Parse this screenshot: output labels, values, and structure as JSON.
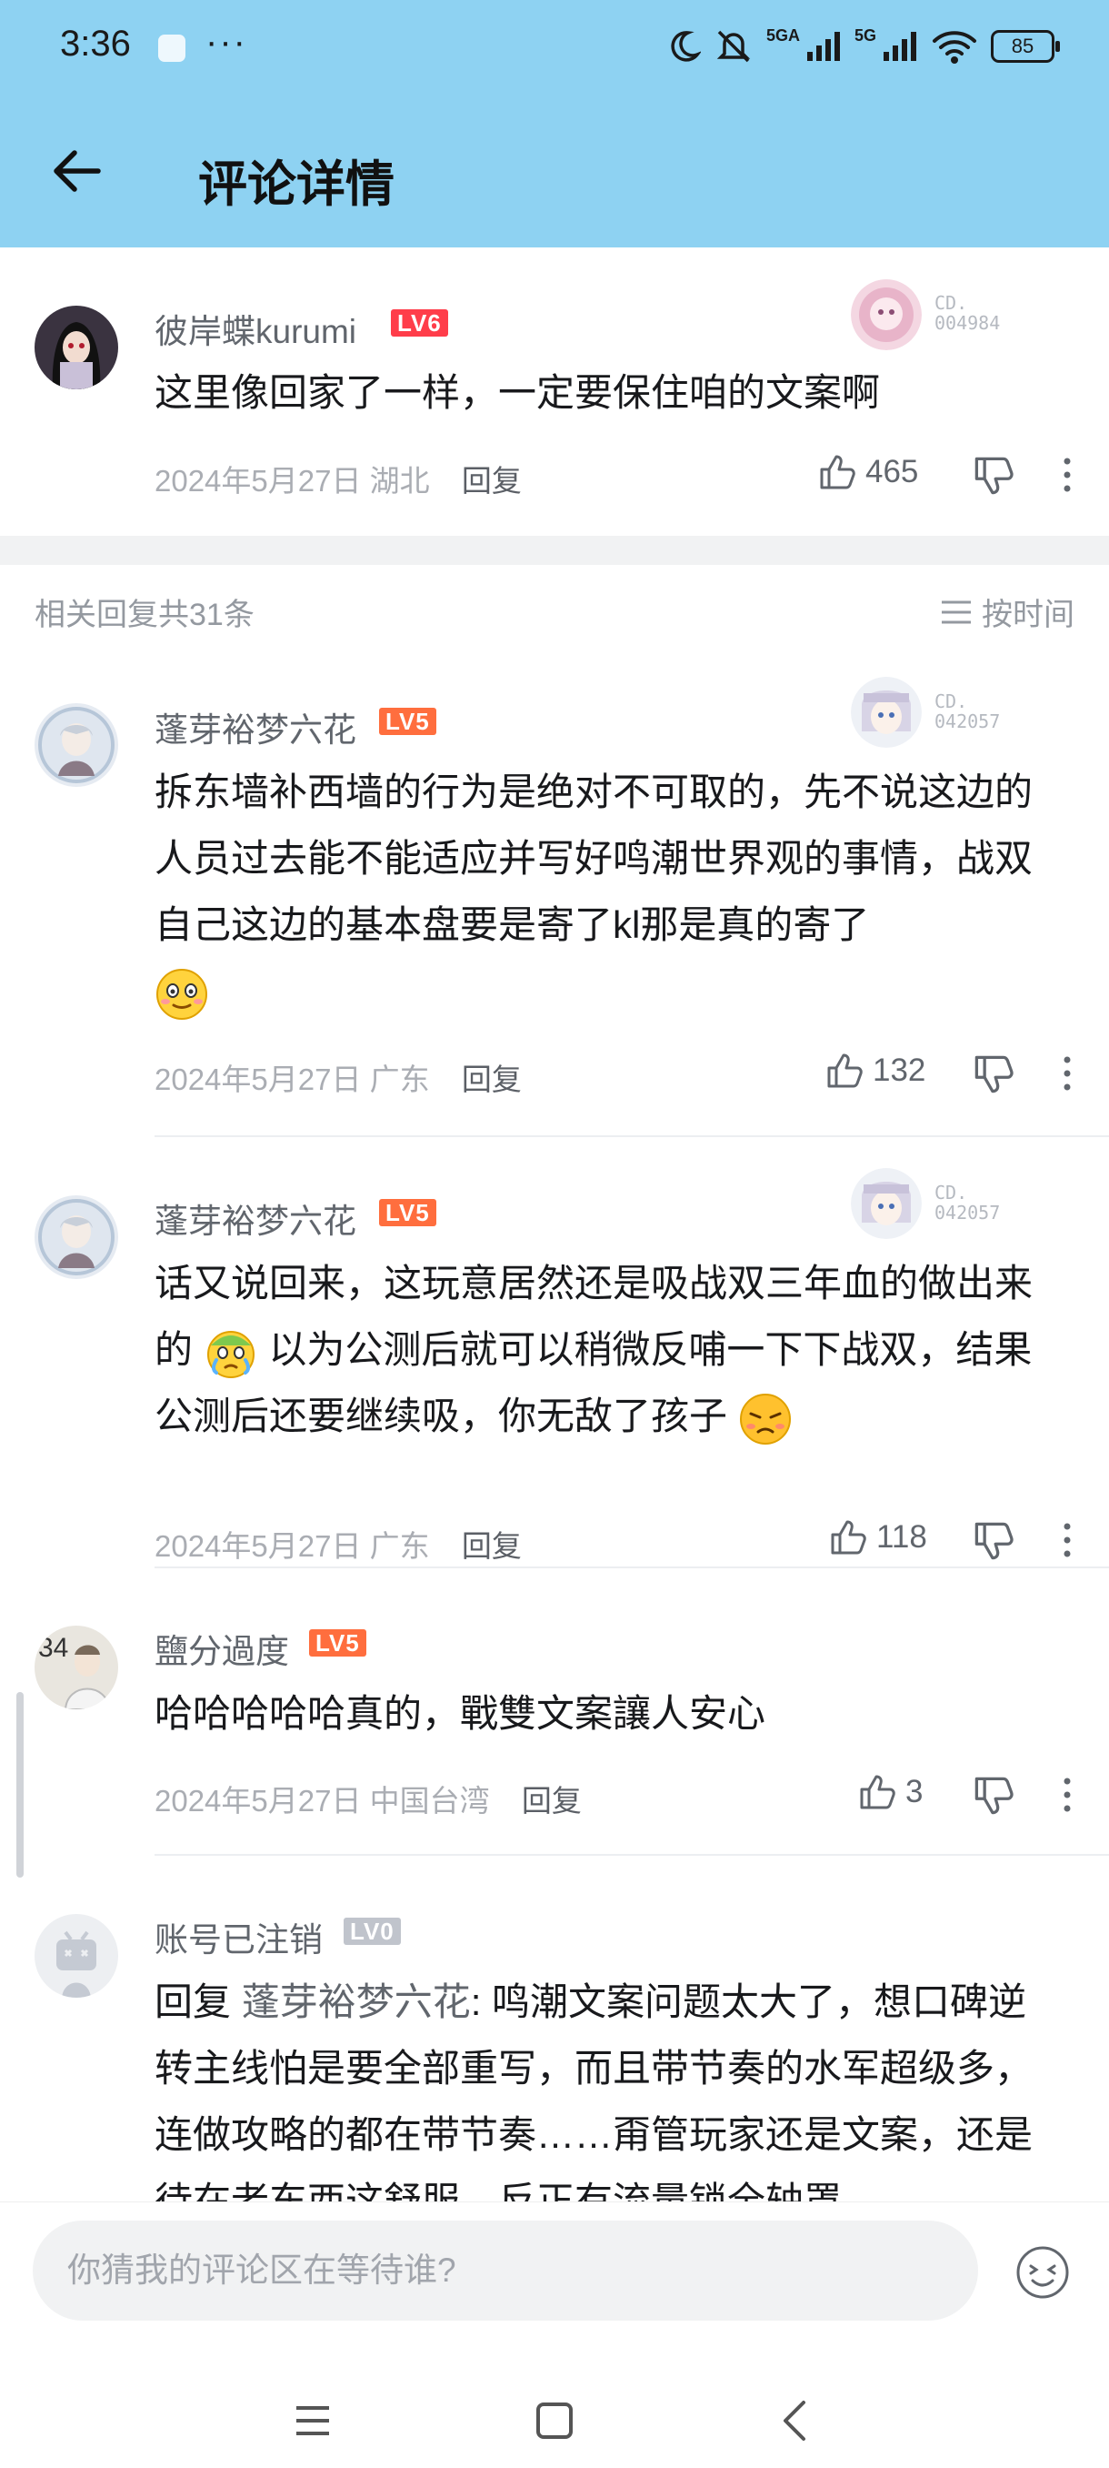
{
  "status_bar": {
    "time": "3:36",
    "dots": "···",
    "network_1": "5GA",
    "network_2": "5G",
    "battery": "85"
  },
  "header": {
    "title": "评论详情"
  },
  "main_comment": {
    "username": "彼岸蝶kurumi",
    "level": "LV6",
    "deco_code": [
      "CD.",
      "004984"
    ],
    "text": "这里像回家了一样，一定要保住咱的文案啊",
    "date": "2024年5月27日",
    "location": "湖北",
    "reply_label": "回复",
    "likes": "465"
  },
  "replies_header": {
    "count_text": "相关回复共31条",
    "sort_label": "按时间"
  },
  "replies": [
    {
      "username": "蓬芽裕梦六花",
      "level": "LV5",
      "deco_code": [
        "CD.",
        "042057"
      ],
      "text": "拆东墙补西墙的行为是绝对不可取的，先不说这边的人员过去能不能适应并写好鸣潮世界观的事情，战双自己这边的基本盘要是寄了kl那是真的寄了",
      "date": "2024年5月27日",
      "location": "广东",
      "reply_label": "回复",
      "likes": "132"
    },
    {
      "username": "蓬芽裕梦六花",
      "level": "LV5",
      "deco_code": [
        "CD.",
        "042057"
      ],
      "text_part1": "话又说回来，这玩意居然还是吸战双三年血的做出来的",
      "text_part2": "以为公测后就可以稍微反哺一下下战双，结果公测后还要继续吸，你无敌了孩子",
      "date": "2024年5月27日",
      "location": "广东",
      "reply_label": "回复",
      "likes": "118"
    },
    {
      "username": "鹽分過度",
      "level": "LV5",
      "text": "哈哈哈哈哈真的，戰雙文案讓人安心",
      "date": "2024年5月27日",
      "location": "中国台湾",
      "reply_label": "回复",
      "likes": "3"
    },
    {
      "username": "账号已注销",
      "level": "LV0",
      "reply_prefix": "回复",
      "mention": "蓬芽裕梦六花",
      "text": ": 鸣潮文案问题太大了，想口碑逆转主线怕是要全部重写，而且带节奏的水军超级多，连做攻略的都在带节奏……甭管玩家还是文案，还是待在老东西这舒服，反正有流量锁全轴罩"
    }
  ],
  "input": {
    "placeholder": "你猜我的评论区在等待谁?"
  }
}
